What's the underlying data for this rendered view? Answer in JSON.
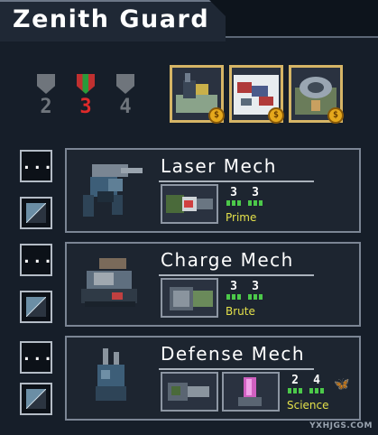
{
  "squad": {
    "title": "Zenith Guard"
  },
  "ranks": [
    {
      "value": "2",
      "state": "inactive"
    },
    {
      "value": "3",
      "state": "active"
    },
    {
      "value": "4",
      "state": "inactive"
    }
  ],
  "achievements": [
    {
      "name": "achievement-1",
      "coin": "$"
    },
    {
      "name": "achievement-2",
      "coin": "$"
    },
    {
      "name": "achievement-3",
      "coin": "$"
    }
  ],
  "row_buttons": {
    "dots": "..."
  },
  "mechs": [
    {
      "name": "Laser Mech",
      "move": "3",
      "health": "3",
      "class": "Prime"
    },
    {
      "name": "Charge Mech",
      "move": "3",
      "health": "3",
      "class": "Brute"
    },
    {
      "name": "Defense Mech",
      "move": "2",
      "health": "4",
      "class": "Science",
      "flying": true
    }
  ],
  "colors": {
    "accent_gold": "#d6b566",
    "class_yellow": "#e3e04a",
    "rank_red": "#e02a2a",
    "stat_green": "#4cc94a"
  },
  "watermark": "YXHJGS.COM"
}
